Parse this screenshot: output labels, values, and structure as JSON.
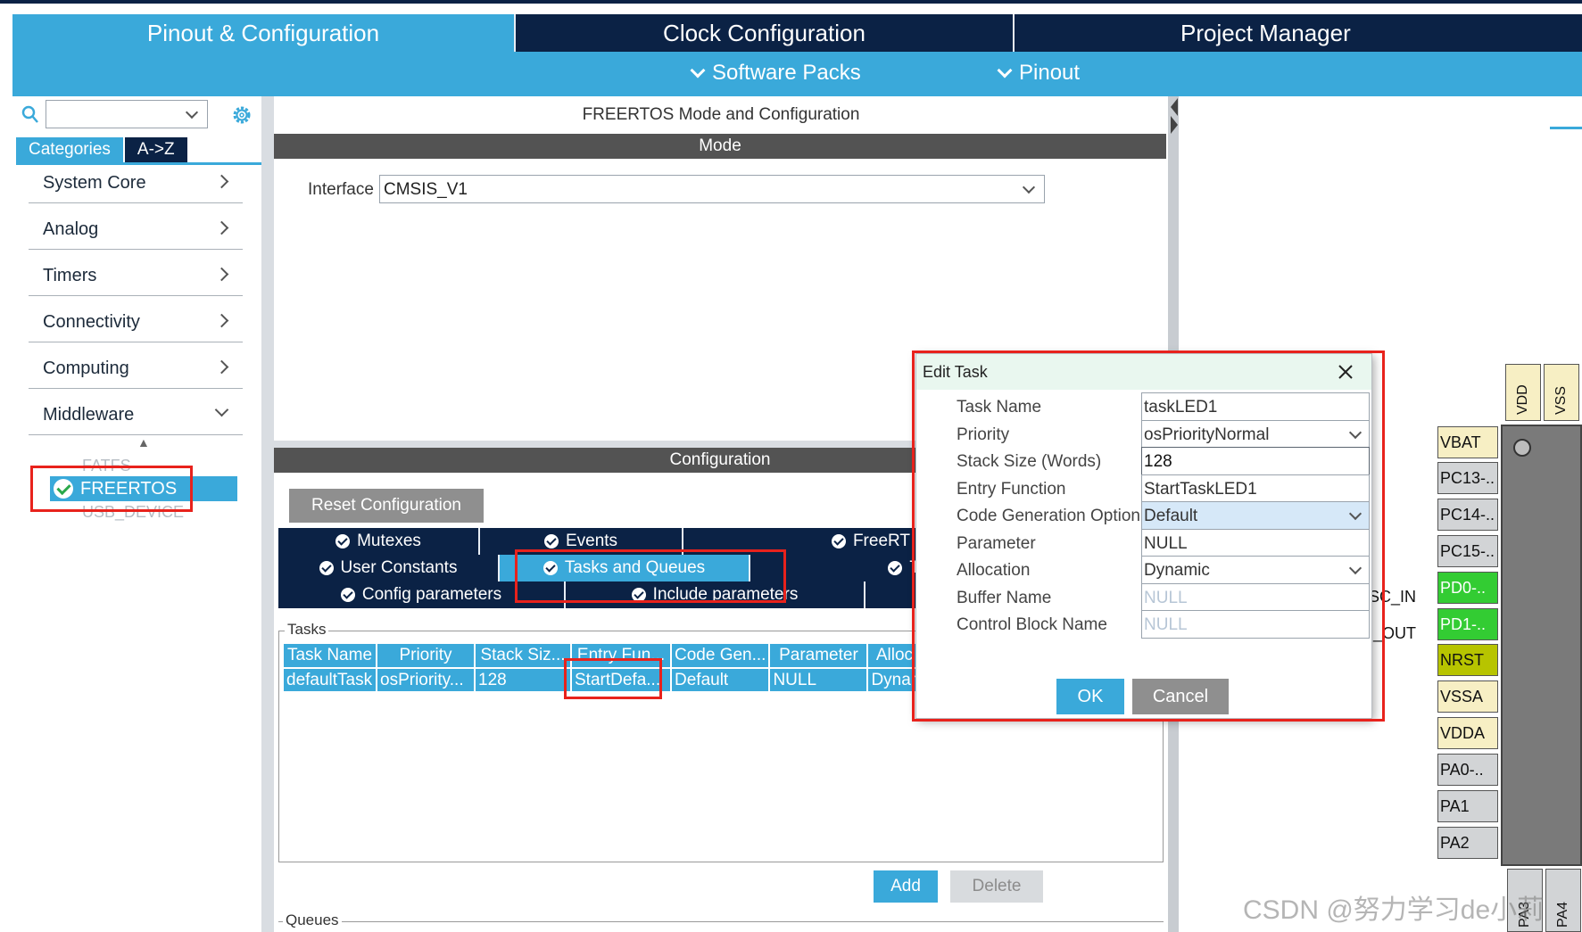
{
  "tabs": [
    {
      "label": "Pinout & Configuration"
    },
    {
      "label": "Clock Configuration"
    },
    {
      "label": "Project Manager"
    }
  ],
  "subbar": {
    "software_packs": "Software Packs",
    "pinout": "Pinout"
  },
  "left": {
    "tab_categories": "Categories",
    "tab_az": "A->Z",
    "categories": [
      {
        "label": "System Core"
      },
      {
        "label": "Analog"
      },
      {
        "label": "Timers"
      },
      {
        "label": "Connectivity"
      },
      {
        "label": "Computing"
      },
      {
        "label": "Middleware"
      }
    ],
    "middleware_items": [
      {
        "label": "FATFS"
      },
      {
        "label": "FREERTOS"
      },
      {
        "label": "USB_DEVICE"
      }
    ]
  },
  "center": {
    "title": "FREERTOS Mode and Configuration",
    "mode_header": "Mode",
    "interface_label": "Interface",
    "interface_value": "CMSIS_V1",
    "config_header": "Configuration",
    "reset_button": "Reset Configuration",
    "param_tabs_row1": [
      "Mutexes",
      "Events",
      "FreeRT"
    ],
    "param_tabs_row2": [
      "User Constants",
      "Tasks and Queues",
      "T"
    ],
    "param_tabs_row3": [
      "Config parameters",
      "Include parameters"
    ],
    "tasks_label": "Tasks",
    "table_headers": [
      "Task Name",
      "Priority",
      "Stack Siz...",
      "Entry Fun...",
      "Code Gen...",
      "Parameter",
      "Alloc"
    ],
    "table_rows": [
      [
        "defaultTask",
        "osPriority...",
        "128",
        "StartDefa...",
        "Default",
        "NULL",
        "Dynar"
      ]
    ],
    "add_button": "Add",
    "delete_button": "Delete",
    "queues_label": "Queues"
  },
  "pins": {
    "top": [
      "VDD",
      "VSS"
    ],
    "left": [
      "VBAT",
      "PC13-..",
      "PC14-..",
      "PC15-..",
      "PD0-..",
      "PD1-..",
      "NRST",
      "VSSA",
      "VDDA",
      "PA0-..",
      "PA1",
      "PA2"
    ],
    "signals": [
      "SC_IN",
      "_OUT"
    ],
    "bottom": [
      "PA3",
      "PA4"
    ]
  },
  "dialog": {
    "title": "Edit Task",
    "fields": [
      {
        "label": "Task Name",
        "value": "taskLED1"
      },
      {
        "label": "Priority",
        "value": "osPriorityNormal"
      },
      {
        "label": "Stack Size (Words)",
        "value": "128"
      },
      {
        "label": "Entry Function",
        "value": "StartTaskLED1"
      },
      {
        "label": "Code Generation Option",
        "value": "Default"
      },
      {
        "label": "Parameter",
        "value": "NULL"
      },
      {
        "label": "Allocation",
        "value": "Dynamic"
      },
      {
        "label": "Buffer Name",
        "value": "NULL"
      },
      {
        "label": "Control Block Name",
        "value": "NULL"
      }
    ],
    "ok": "OK",
    "cancel": "Cancel"
  },
  "watermark": "CSDN @努力学习de小莉",
  "colors": {
    "accent": "#3aa9da",
    "dark_navy": "#0b2245",
    "highlight_red": "#e8221c",
    "pin_green": "#33cc33",
    "pin_yellow": "#f7efc4"
  }
}
